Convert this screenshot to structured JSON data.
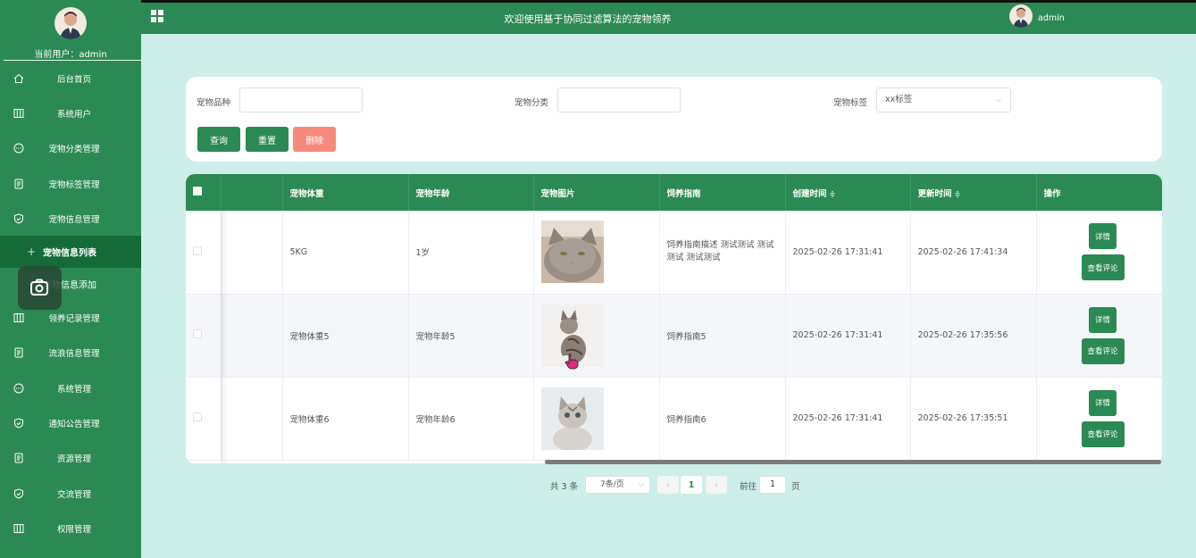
{
  "sidebar": {
    "current_user": "当前用户：admin",
    "items": [
      {
        "label": "后台首页",
        "icon": "home-icon"
      },
      {
        "label": "系统用户",
        "icon": "columns-icon"
      },
      {
        "label": "宠物分类管理",
        "icon": "chat-icon"
      },
      {
        "label": "宠物标签管理",
        "icon": "document-icon"
      },
      {
        "label": "宠物信息管理",
        "icon": "shield-icon"
      }
    ],
    "subitems": [
      {
        "label": "宠物信息列表",
        "prefix": "+"
      },
      {
        "label": "宠物信息添加"
      }
    ],
    "items_after": [
      {
        "label": "领养记录管理",
        "icon": "columns-icon"
      },
      {
        "label": "流浪信息管理",
        "icon": "document-icon"
      },
      {
        "label": "系统管理",
        "icon": "chat-icon"
      },
      {
        "label": "通知公告管理",
        "icon": "shield-icon"
      },
      {
        "label": "资源管理",
        "icon": "document-icon"
      },
      {
        "label": "交流管理",
        "icon": "shield-icon"
      },
      {
        "label": "权限管理",
        "icon": "columns-icon"
      }
    ]
  },
  "topbar": {
    "title": "欢迎使用基于协同过滤算法的宠物领养",
    "username": "admin"
  },
  "search": {
    "breed_label": "宠物品种",
    "category_label": "宠物分类",
    "tag_label": "宠物标签",
    "tag_value": "xx标签",
    "query_btn": "查询",
    "reset_btn": "重置",
    "delete_btn": "删除"
  },
  "table": {
    "headers": {
      "weight": "宠物体重",
      "age": "宠物年龄",
      "image": "宠物图片",
      "guide": "饲养指南",
      "created": "创建时间",
      "updated": "更新时间",
      "ops": "操作"
    },
    "sort_glyph": "≑",
    "detail_btn": "详情",
    "comment_btn": "查看评论",
    "rows": [
      {
        "weight": "5KG",
        "age": "1岁",
        "guide": "饲养指南描述 测试测试 测试测试 测试测试",
        "created": "2025-02-26 17:31:41",
        "updated": "2025-02-26 17:41:34"
      },
      {
        "weight": "宠物体重5",
        "age": "宠物年龄5",
        "guide": "饲养指南5",
        "created": "2025-02-26 17:31:41",
        "updated": "2025-02-26 17:35:56"
      },
      {
        "weight": "宠物体重6",
        "age": "宠物年龄6",
        "guide": "饲养指南6",
        "created": "2025-02-26 17:31:41",
        "updated": "2025-02-26 17:35:51"
      }
    ]
  },
  "pager": {
    "total": "共 3 条",
    "page_size": "7条/页",
    "prev": "‹",
    "current": "1",
    "next": "›",
    "goto_prefix": "前往",
    "goto_value": "1",
    "goto_suffix": "页"
  },
  "colors": {
    "primary": "#2b8a53",
    "sidebar_active": "#146b37",
    "background": "#cdeee9",
    "delete": "#f78a7c"
  }
}
